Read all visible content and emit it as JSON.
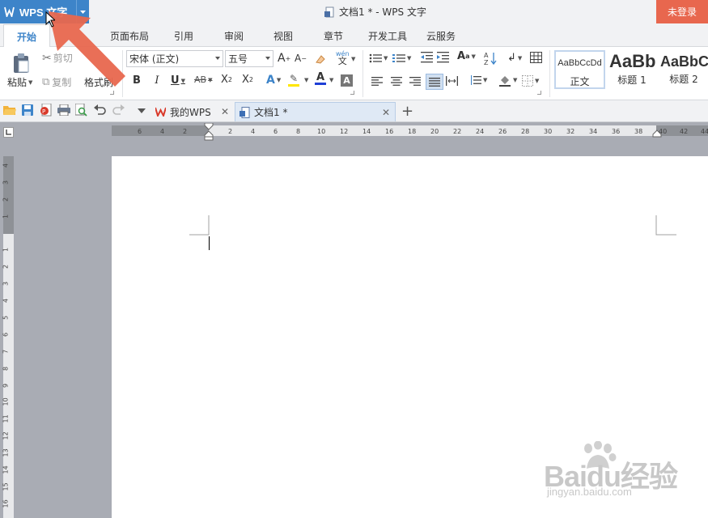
{
  "app_menu": {
    "label": "WPS 文字"
  },
  "title_bar": {
    "doc_title": "文档1 * - WPS 文字",
    "login_label": "未登录"
  },
  "menu_tabs": [
    {
      "label": "开始",
      "active": true
    },
    {
      "label": "页面布局"
    },
    {
      "label": "引用"
    },
    {
      "label": "审阅"
    },
    {
      "label": "视图"
    },
    {
      "label": "章节"
    },
    {
      "label": "开发工具"
    },
    {
      "label": "云服务"
    }
  ],
  "ribbon": {
    "clipboard": {
      "paste": "粘贴",
      "cut": "剪切",
      "copy": "复制",
      "format_painter": "格式刷"
    },
    "font": {
      "name": "宋体 (正文)",
      "size": "五号"
    },
    "styles": [
      {
        "preview": "AaBbCcDd",
        "label": "正文"
      },
      {
        "preview": "AaBb",
        "label": "标题 1"
      },
      {
        "preview": "AaBbC",
        "label": "标题 2"
      }
    ],
    "phonetic": "wén\n文"
  },
  "quick_access_tabs": [
    {
      "label": "我的WPS"
    },
    {
      "label": "文档1 *",
      "active": true
    }
  ],
  "rulers": {
    "horizontal_left": [
      "6",
      "4",
      "2"
    ],
    "horizontal_right": [
      "2",
      "4",
      "6",
      "8",
      "10",
      "12",
      "14",
      "16",
      "18",
      "20",
      "22",
      "24",
      "26",
      "28",
      "30",
      "32",
      "34",
      "36",
      "38",
      "40",
      "42",
      "44"
    ],
    "vertical_top": [
      "4",
      "3",
      "2",
      "1"
    ],
    "vertical_bottom": [
      "1",
      "2",
      "3",
      "4",
      "5",
      "6",
      "7",
      "8",
      "9",
      "10",
      "11",
      "12",
      "13",
      "14",
      "15",
      "16"
    ]
  },
  "watermark": {
    "brand": "Baidu经验",
    "url": "jingyan.baidu.com"
  },
  "colors": {
    "accent": "#3d84c9",
    "login": "#e8674e",
    "arrow": "#e8674e"
  }
}
